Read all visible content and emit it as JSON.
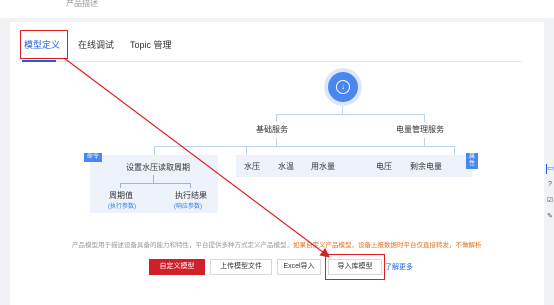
{
  "header": {
    "product_desc_label": "产品描述"
  },
  "tabs": [
    {
      "label": "模型定义"
    },
    {
      "label": "在线调试"
    },
    {
      "label": "Topic 管理"
    }
  ],
  "diagram": {
    "root_icon": "model-icon",
    "groups": [
      {
        "label": "基础服务"
      },
      {
        "label": "电量管理服务"
      }
    ],
    "command": {
      "tag": "命令",
      "title": "设置水压读取周期",
      "param_label": "周期值",
      "param_sub": "(执行参数)",
      "result_label": "执行结果",
      "result_sub": "(响应参数)"
    },
    "properties": {
      "tag": "属性",
      "items": [
        "水压",
        "水温",
        "用水量",
        "电压",
        "剩余电量"
      ]
    }
  },
  "note": {
    "text": "产品模型用于描述设备具备的能力和特性，平台提供多种方式定义产品模型，",
    "warning": "如果自定义产品模型，设备上报数据时平台仅直接转发，不做解析"
  },
  "actions": {
    "custom_model": "自定义模型",
    "upload_file": "上传模型文件",
    "excel_import": "Excel导入",
    "import_library": "导入库模型",
    "learn_more": "了解更多"
  },
  "colors": {
    "accent": "#1f5fde",
    "primary_button": "#d0202a",
    "annotation": "#e02020"
  },
  "right_tools": [
    "chat-icon",
    "help-icon",
    "checklist-icon",
    "feedback-icon"
  ]
}
